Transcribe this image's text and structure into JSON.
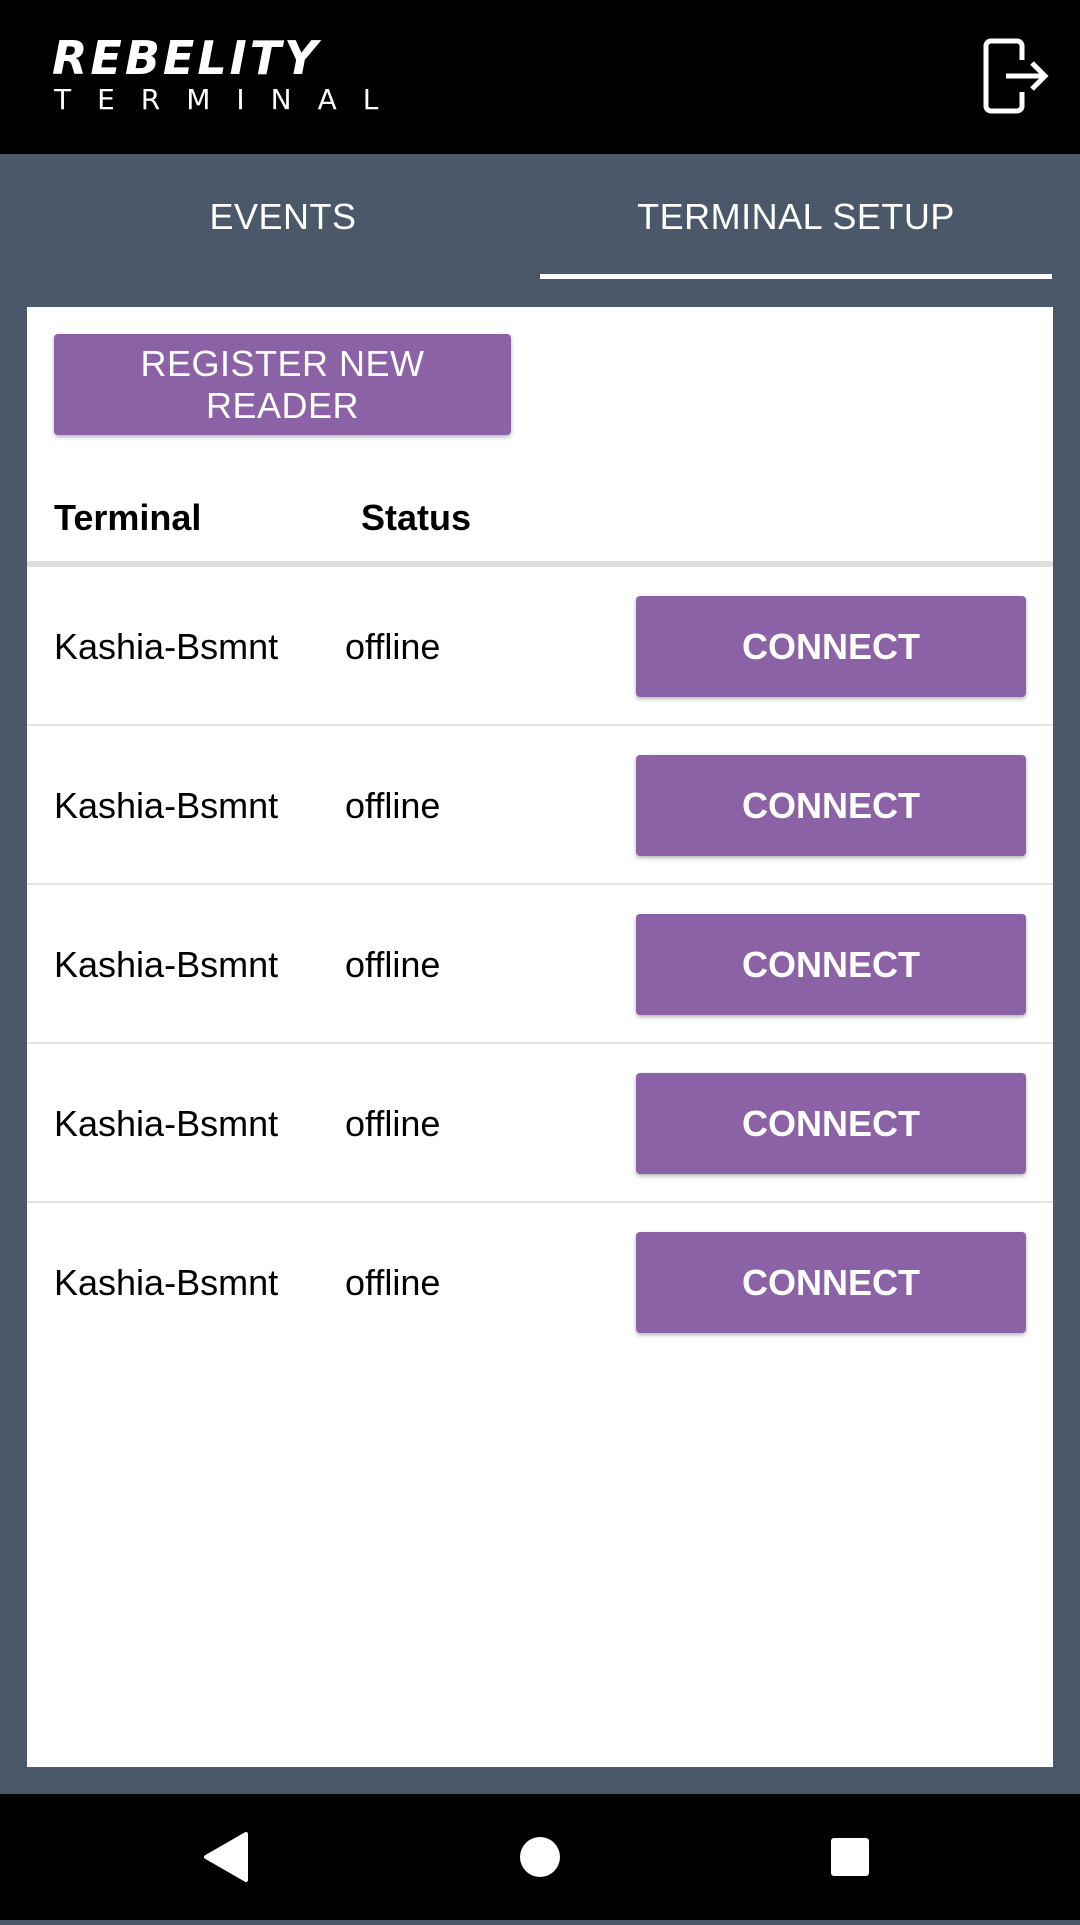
{
  "app": {
    "logo_word": "REBELITY",
    "logo_sub": "TERMINAL",
    "logout_icon": "logout-icon"
  },
  "tabs": [
    {
      "label": "EVENTS",
      "active": false
    },
    {
      "label": "TERMINAL SETUP",
      "active": true
    }
  ],
  "toolbar": {
    "register_label": "REGISTER NEW READER"
  },
  "table": {
    "headers": [
      "Terminal",
      "Status"
    ],
    "rows": [
      {
        "name": "Kashia-Bsmnt",
        "status": "offline",
        "action": "CONNECT"
      },
      {
        "name": "Kashia-Bsmnt",
        "status": "offline",
        "action": "CONNECT"
      },
      {
        "name": "Kashia-Bsmnt",
        "status": "offline",
        "action": "CONNECT"
      },
      {
        "name": "Kashia-Bsmnt",
        "status": "offline",
        "action": "CONNECT"
      },
      {
        "name": "Kashia-Bsmnt",
        "status": "offline",
        "action": "CONNECT"
      }
    ]
  },
  "colors": {
    "accent": "#8c62a6",
    "background": "#4a5869",
    "appbar": "#000000",
    "logo_red": "#d92027"
  },
  "navbar": {
    "icons": [
      "back-icon",
      "home-icon",
      "recents-icon"
    ]
  }
}
